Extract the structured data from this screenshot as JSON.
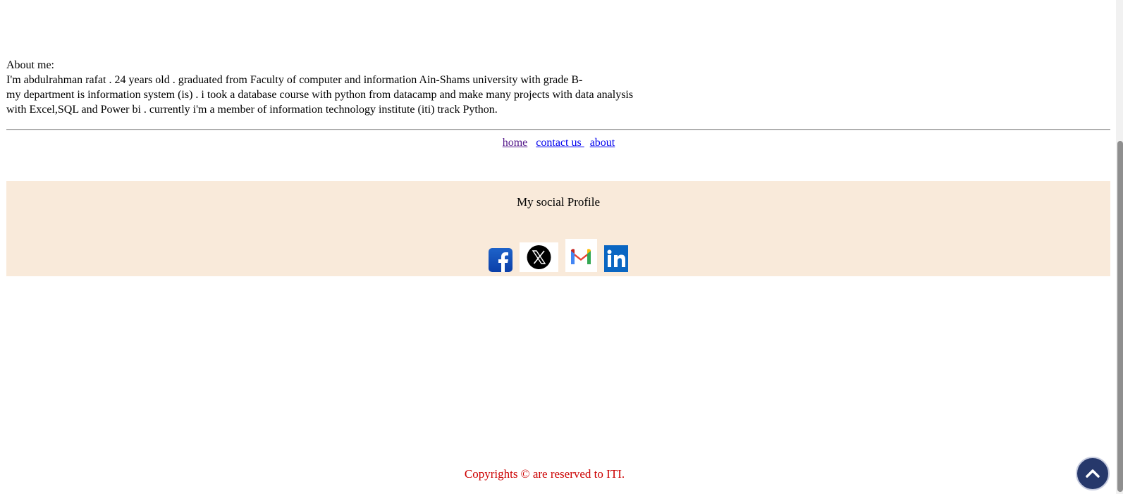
{
  "about": {
    "heading": "About me:",
    "lines": [
      "I'm abdulrahman rafat . 24 years old . graduated from Faculty of computer and information Ain-Shams university with grade B-",
      "my department is information system (is) . i took a database course with python from datacamp and make many projects with data analysis",
      "with Excel,SQL and Power bi . currently i'm a member of information technology institute (iti) track Python."
    ]
  },
  "nav": {
    "home": "home",
    "contact": "contact us ",
    "about": "about"
  },
  "social": {
    "title": "My social Profile",
    "icons": [
      "facebook-icon",
      "x-twitter-icon",
      "gmail-icon",
      "linkedin-icon"
    ]
  },
  "footer": {
    "copyright": "Copyrights © are reserved to ITI."
  },
  "colors": {
    "social_bg": "#f9eada",
    "copyright": "#cc0000",
    "link": "#0000ee",
    "visited_link": "#551a8b",
    "to_top_button": "#26386b"
  },
  "to_top": {
    "icon": "chevron-up-icon"
  }
}
